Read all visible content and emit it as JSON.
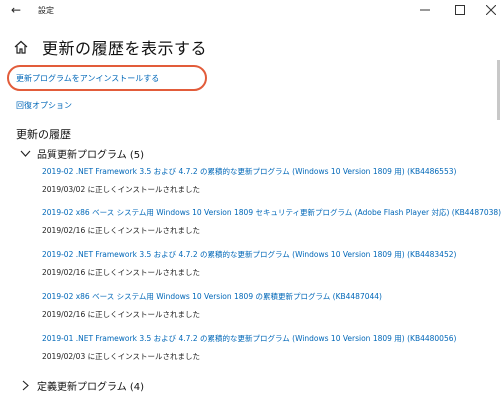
{
  "window": {
    "title": "設定",
    "back_icon": "back-arrow-icon",
    "controls": [
      "minimize-icon",
      "maximize-icon",
      "close-icon"
    ]
  },
  "header": {
    "home_icon": "home-icon",
    "title": "更新の履歴を表示する"
  },
  "links": {
    "uninstall": "更新プログラムをアンインストールする",
    "recovery": "回復オプション"
  },
  "history": {
    "title": "更新の履歴",
    "groups": [
      {
        "label": "品質更新プログラム (5)",
        "expanded": true,
        "items": [
          {
            "name": "2019-02 .NET Framework 3.5 および 4.7.2 の累積的な更新プログラム (Windows 10 Version 1809 用) (KB4486553)",
            "status": "2019/03/02 に正しくインストールされました"
          },
          {
            "name": "2019-02 x86 ベース システム用 Windows 10 Version 1809 セキュリティ更新プログラム (Adobe Flash Player 対応) (KB4487038)",
            "status": "2019/02/16 に正しくインストールされました"
          },
          {
            "name": "2019-02 .NET Framework 3.5 および 4.7.2 の累積的な更新プログラム (Windows 10 Version 1809 用) (KB4483452)",
            "status": "2019/02/16 に正しくインストールされました"
          },
          {
            "name": "2019-02 x86 ベース システム用 Windows 10 Version 1809 の累積更新プログラム (KB4487044)",
            "status": "2019/02/16 に正しくインストールされました"
          },
          {
            "name": "2019-01 .NET Framework 3.5 および 4.7.2 の累積的な更新プログラム (Windows 10 Version 1809 用) (KB4480056)",
            "status": "2019/02/03 に正しくインストールされました"
          }
        ]
      },
      {
        "label": "定義更新プログラム (4)",
        "expanded": false
      }
    ]
  },
  "colors": {
    "link": "#0067b8",
    "highlight_ring": "#e25c3a",
    "background": "#ffffff"
  }
}
